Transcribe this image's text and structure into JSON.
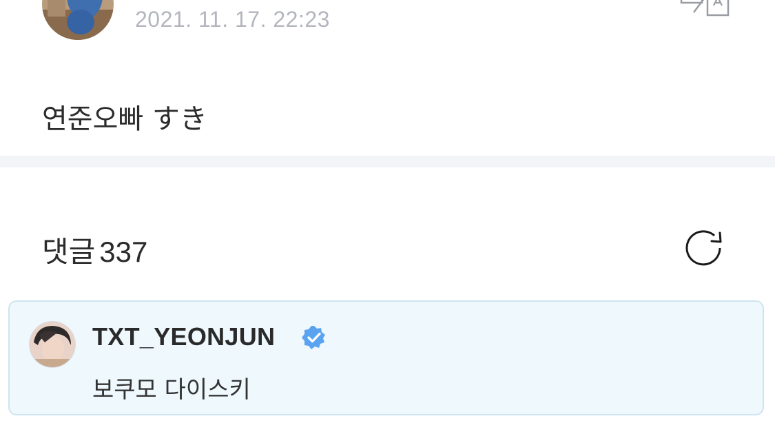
{
  "post": {
    "timestamp": "2021. 11. 17. 22:23",
    "text": "연준오빠 すき"
  },
  "comments": {
    "title": "댓글",
    "count": "337"
  },
  "pinned_comment": {
    "author": "TXT_YEONJUN",
    "text": "보쿠모 다이스키"
  },
  "icons": {
    "translate": "translate-icon",
    "refresh": "refresh-icon",
    "verified": "verified-badge-icon"
  },
  "colors": {
    "timestamp": "#b3b6bd",
    "divider": "#f3f4f8",
    "pinned_background": "#eef8fd",
    "pinned_border": "#cfe4f1",
    "verified": "#5aa3f0",
    "text": "#2b2b2b"
  }
}
